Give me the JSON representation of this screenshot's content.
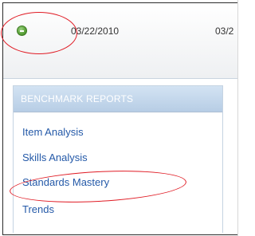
{
  "row": {
    "dates": [
      "03/22/2010",
      "03/2"
    ]
  },
  "panel": {
    "title": "BENCHMARK REPORTS",
    "items": [
      "Item Analysis",
      "Skills Analysis",
      "Standards Mastery",
      "Trends"
    ]
  },
  "colors": {
    "accent_green": "#5da43b",
    "link_blue": "#2459a8",
    "header_blue": "#b7cde5",
    "annotation_red": "#e01b24"
  },
  "icons": {
    "row_toggle": "collapse-minus-icon"
  }
}
